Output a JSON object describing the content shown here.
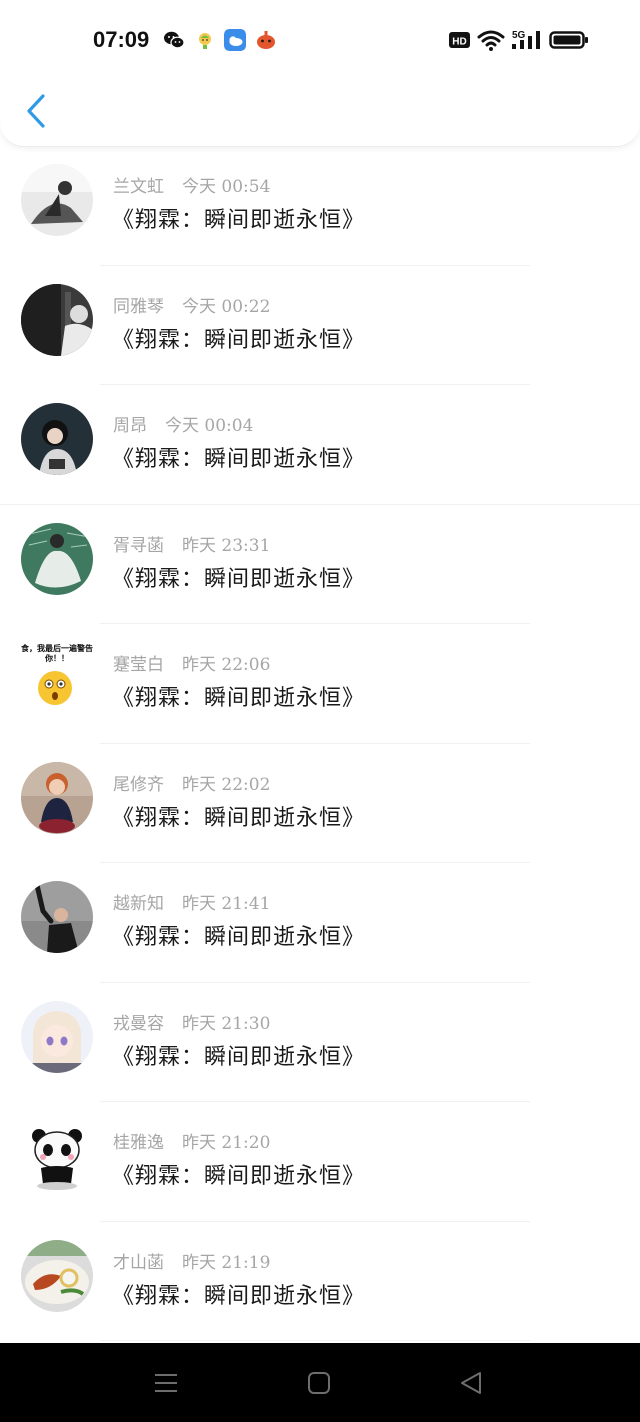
{
  "status_bar": {
    "time": "07:09",
    "notification_icons": [
      "wechat-icon",
      "sprout-icon",
      "weather-icon",
      "game-icon"
    ],
    "right_icons": [
      "hd-icon",
      "wifi-icon",
      "5g-signal-icon",
      "battery-icon"
    ],
    "hd_label": "HD",
    "network_label": "5G"
  },
  "header": {
    "back_icon": "chevron-left-icon",
    "accent_color": "#2f9be6"
  },
  "messages": [
    {
      "name": "兰文虹",
      "time": "今天 00:54",
      "text": "《翔霖：瞬间即逝永恒》"
    },
    {
      "name": "同雅琴",
      "time": "今天 00:22",
      "text": "《翔霖：瞬间即逝永恒》"
    },
    {
      "name": "周昂",
      "time": "今天 00:04",
      "text": "《翔霖：瞬间即逝永恒》"
    },
    {
      "name": "胥寻菡",
      "time": "昨天 23:31",
      "text": "《翔霖：瞬间即逝永恒》"
    },
    {
      "name": "蹇莹白",
      "time": "昨天 22:06",
      "text": "《翔霖：瞬间即逝永恒》"
    },
    {
      "name": "尾修齐",
      "time": "昨天 22:02",
      "text": "《翔霖：瞬间即逝永恒》"
    },
    {
      "name": "越新知",
      "time": "昨天 21:41",
      "text": "《翔霖：瞬间即逝永恒》"
    },
    {
      "name": "戎曼容",
      "time": "昨天 21:30",
      "text": "《翔霖：瞬间即逝永恒》"
    },
    {
      "name": "桂雅逸",
      "time": "昨天 21:20",
      "text": "《翔霖：瞬间即逝永恒》"
    },
    {
      "name": "才山菡",
      "time": "昨天 21:19",
      "text": "《翔霖：瞬间即逝永恒》"
    }
  ],
  "avatar_sticker_text": "食，我最后一遍警告你！！",
  "nav_bar": {
    "icons": [
      "menu-icon",
      "home-icon",
      "back-triangle-icon"
    ]
  }
}
